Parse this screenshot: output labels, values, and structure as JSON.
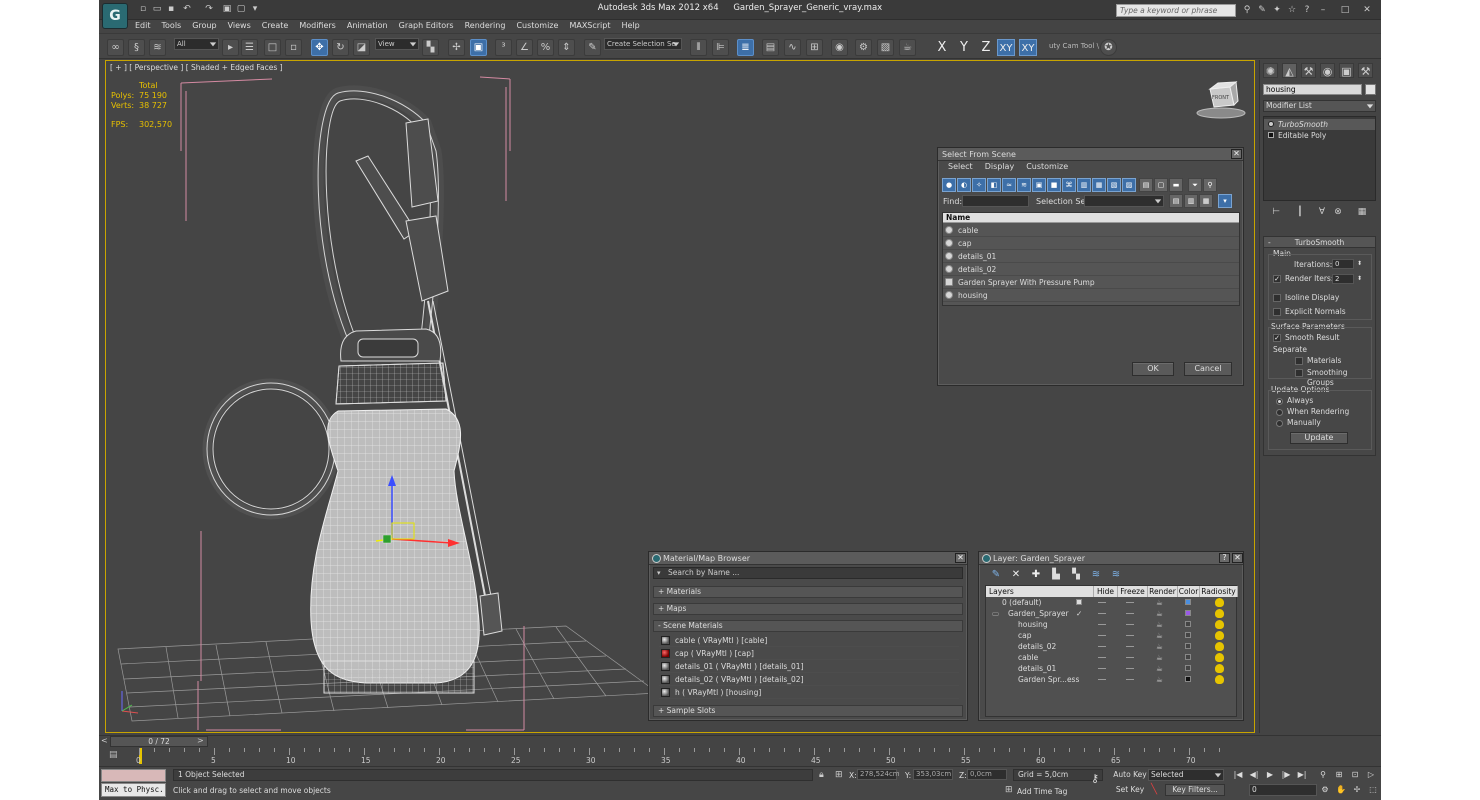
{
  "window": {
    "app_title": "Autodesk 3ds Max  2012 x64",
    "file_name": "Garden_Sprayer_Generic_vray.max",
    "search_placeholder": "Type a keyword or phrase",
    "logo_letter": "G"
  },
  "menu": [
    "Edit",
    "Tools",
    "Group",
    "Views",
    "Create",
    "Modifiers",
    "Animation",
    "Graph Editors",
    "Rendering",
    "Customize",
    "MAXScript",
    "Help"
  ],
  "toolbar": {
    "filter_dropdown": "All",
    "view_dropdown": "View",
    "selection_set_dropdown": "Create Selection Se",
    "axis_x": "X",
    "axis_y": "Y",
    "axis_z": "Z",
    "axis_xy": "XY",
    "axis_xy2": "XY",
    "cam_tool": "uty Cam Tool \\"
  },
  "viewport": {
    "label": "[ + ] [ Perspective ] [ Shaded + Edged Faces ]",
    "stats_header": "Total",
    "polys_label": "Polys:",
    "polys_value": "75 190",
    "verts_label": "Verts:",
    "verts_value": "38 727",
    "fps_label": "FPS:",
    "fps_value": "302,570",
    "viewcube_label": "FRONT"
  },
  "select_from_scene": {
    "title": "Select From Scene",
    "menu": [
      "Select",
      "Display",
      "Customize"
    ],
    "find_label": "Find:",
    "find_value": "",
    "selection_set_label": "Selection Set:",
    "column_name": "Name",
    "items": [
      "cable",
      "cap",
      "details_01",
      "details_02",
      "Garden Sprayer With Pressure Pump",
      "housing"
    ],
    "ok": "OK",
    "cancel": "Cancel"
  },
  "command_panel": {
    "object_name": "housing",
    "modifier_list": "Modifier List",
    "stack": [
      "TurboSmooth",
      "Editable Poly"
    ],
    "rollout_title": "TurboSmooth",
    "main_label": "Main",
    "iterations_label": "Iterations:",
    "iterations_value": "0",
    "render_iters_label": "Render Iters:",
    "render_iters_value": "2",
    "render_iters_checked": true,
    "isoline_display": "Isoline Display",
    "explicit_normals": "Explicit Normals",
    "surface_params": "Surface Parameters",
    "smooth_result": "Smooth Result",
    "separate": "Separate",
    "materials": "Materials",
    "smoothing_groups": "Smoothing Groups",
    "update_options": "Update Options",
    "always": "Always",
    "when_rendering": "When Rendering",
    "manually": "Manually",
    "update_button": "Update"
  },
  "material_browser": {
    "title": "Material/Map Browser",
    "search_placeholder": "Search by Name ...",
    "sec_materials": "+ Materials",
    "sec_maps": "+ Maps",
    "sec_scene": "- Scene Materials",
    "items": [
      "cable  ( VRayMtl ) [cable]",
      "cap  ( VRayMtl ) [cap]",
      "details_01  ( VRayMtl ) [details_01]",
      "details_02  ( VRayMtl ) [details_02]",
      "h  ( VRayMtl ) [housing]"
    ],
    "sec_sample": "+ Sample Slots"
  },
  "layer_dialog": {
    "title": "Layer: Garden_Sprayer",
    "col_layers": "Layers",
    "col_hide": "Hide",
    "col_freeze": "Freeze",
    "col_render": "Render",
    "col_color": "Color",
    "col_radiosity": "Radiosity",
    "rows": [
      {
        "name": "0 (default)",
        "color": "#4a8fe0"
      },
      {
        "name": "Garden_Sprayer",
        "color": "#9a5ae8"
      },
      {
        "name": "housing",
        "color": "#444444"
      },
      {
        "name": "cap",
        "color": "#444444"
      },
      {
        "name": "details_02",
        "color": "#444444"
      },
      {
        "name": "cable",
        "color": "#444444"
      },
      {
        "name": "details_01",
        "color": "#444444"
      },
      {
        "name": "Garden Spr...ess",
        "color": "#111111"
      }
    ]
  },
  "timeline": {
    "slider": "0 / 72",
    "ticks": [
      "0",
      "5",
      "10",
      "15",
      "20",
      "25",
      "30",
      "35",
      "40",
      "45",
      "50",
      "55",
      "60",
      "65",
      "70"
    ]
  },
  "status": {
    "maxscript_output": "Max to Physc.",
    "selection": "1 Object Selected",
    "prompt": "Click and drag to select and move objects",
    "x_label": "X:",
    "x_value": "278,524cm",
    "y_label": "Y:",
    "y_value": "353,03cm",
    "z_label": "Z:",
    "z_value": "0,0cm",
    "grid": "Grid = 5,0cm",
    "add_time_tag": "Add Time Tag",
    "auto_key": "Auto Key",
    "set_key": "Set Key",
    "key_mode": "Selected",
    "key_filters": "Key Filters...",
    "frame": "0"
  }
}
